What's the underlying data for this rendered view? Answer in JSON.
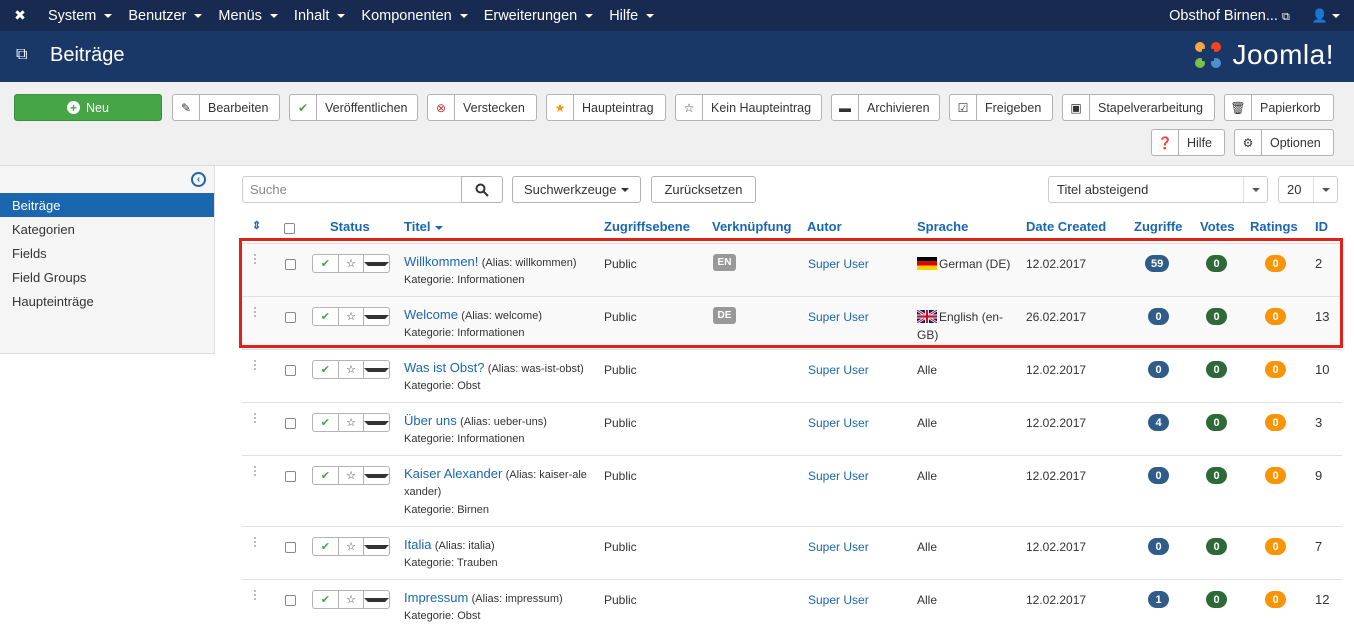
{
  "topbar": {
    "menu": [
      "System",
      "Benutzer",
      "Menüs",
      "Inhalt",
      "Komponenten",
      "Erweiterungen",
      "Hilfe"
    ],
    "site_label": "Obsthof Birnen..."
  },
  "header": {
    "title": "Beiträge",
    "logo_text": "Joomla!"
  },
  "toolbar": {
    "new": "Neu",
    "edit": "Bearbeiten",
    "publish": "Veröffentlichen",
    "unpublish": "Verstecken",
    "feature": "Haupteintrag",
    "unfeature": "Kein Haupteintrag",
    "archive": "Archivieren",
    "checkin": "Freigeben",
    "batch": "Stapelverarbeitung",
    "trash": "Papierkorb",
    "help": "Hilfe",
    "options": "Optionen"
  },
  "sidebar": {
    "items": [
      "Beiträge",
      "Kategorien",
      "Fields",
      "Field Groups",
      "Haupteinträge"
    ]
  },
  "filters": {
    "search_placeholder": "Suche",
    "search_tools": "Suchwerkzeuge",
    "reset": "Zurücksetzen",
    "ordering": "Titel absteigend",
    "limit": "20"
  },
  "columns": {
    "status": "Status",
    "title": "Titel",
    "access": "Zugriffsebene",
    "association": "Verknüpfung",
    "author": "Autor",
    "language": "Sprache",
    "date": "Date Created",
    "hits": "Zugriffe",
    "votes": "Votes",
    "ratings": "Ratings",
    "id": "ID"
  },
  "rows": [
    {
      "title": "Willkommen!",
      "alias": "(Alias: willkommen)",
      "alias2": "",
      "category": "Kategorie: Informationen",
      "access": "Public",
      "assoc": "EN",
      "author": "Super User",
      "language": "German (DE)",
      "language2": "",
      "date": "12.02.2017",
      "hits": "59",
      "votes": "0",
      "ratings": "0",
      "id": "2"
    },
    {
      "title": "Welcome",
      "alias": "(Alias: welcome)",
      "alias2": "",
      "category": "Kategorie: Informationen",
      "access": "Public",
      "assoc": "DE",
      "author": "Super User",
      "language": "English (en-",
      "language2": "GB)",
      "date": "26.02.2017",
      "hits": "0",
      "votes": "0",
      "ratings": "0",
      "id": "13"
    },
    {
      "title": "Was ist Obst?",
      "alias": "(Alias: was-ist-obst)",
      "alias2": "",
      "category": "Kategorie: Obst",
      "access": "Public",
      "assoc": "",
      "author": "Super User",
      "language": "Alle",
      "language2": "",
      "date": "12.02.2017",
      "hits": "0",
      "votes": "0",
      "ratings": "0",
      "id": "10"
    },
    {
      "title": "Über uns",
      "alias": "(Alias: ueber-uns)",
      "alias2": "",
      "category": "Kategorie: Informationen",
      "access": "Public",
      "assoc": "",
      "author": "Super User",
      "language": "Alle",
      "language2": "",
      "date": "12.02.2017",
      "hits": "4",
      "votes": "0",
      "ratings": "0",
      "id": "3"
    },
    {
      "title": "Kaiser Alexander",
      "alias": "(Alias: kaiser-ale",
      "alias2": "xander)",
      "category": "Kategorie: Birnen",
      "access": "Public",
      "assoc": "",
      "author": "Super User",
      "language": "Alle",
      "language2": "",
      "date": "12.02.2017",
      "hits": "0",
      "votes": "0",
      "ratings": "0",
      "id": "9"
    },
    {
      "title": "Italia",
      "alias": "(Alias: italia)",
      "alias2": "",
      "category": "Kategorie: Trauben",
      "access": "Public",
      "assoc": "",
      "author": "Super User",
      "language": "Alle",
      "language2": "",
      "date": "12.02.2017",
      "hits": "0",
      "votes": "0",
      "ratings": "0",
      "id": "7"
    },
    {
      "title": "Impressum",
      "alias": "(Alias: impressum)",
      "alias2": "",
      "category": "Kategorie: Obst",
      "access": "Public",
      "assoc": "",
      "author": "Super User",
      "language": "Alle",
      "language2": "",
      "date": "12.02.2017",
      "hits": "1",
      "votes": "0",
      "ratings": "0",
      "id": "12"
    }
  ]
}
